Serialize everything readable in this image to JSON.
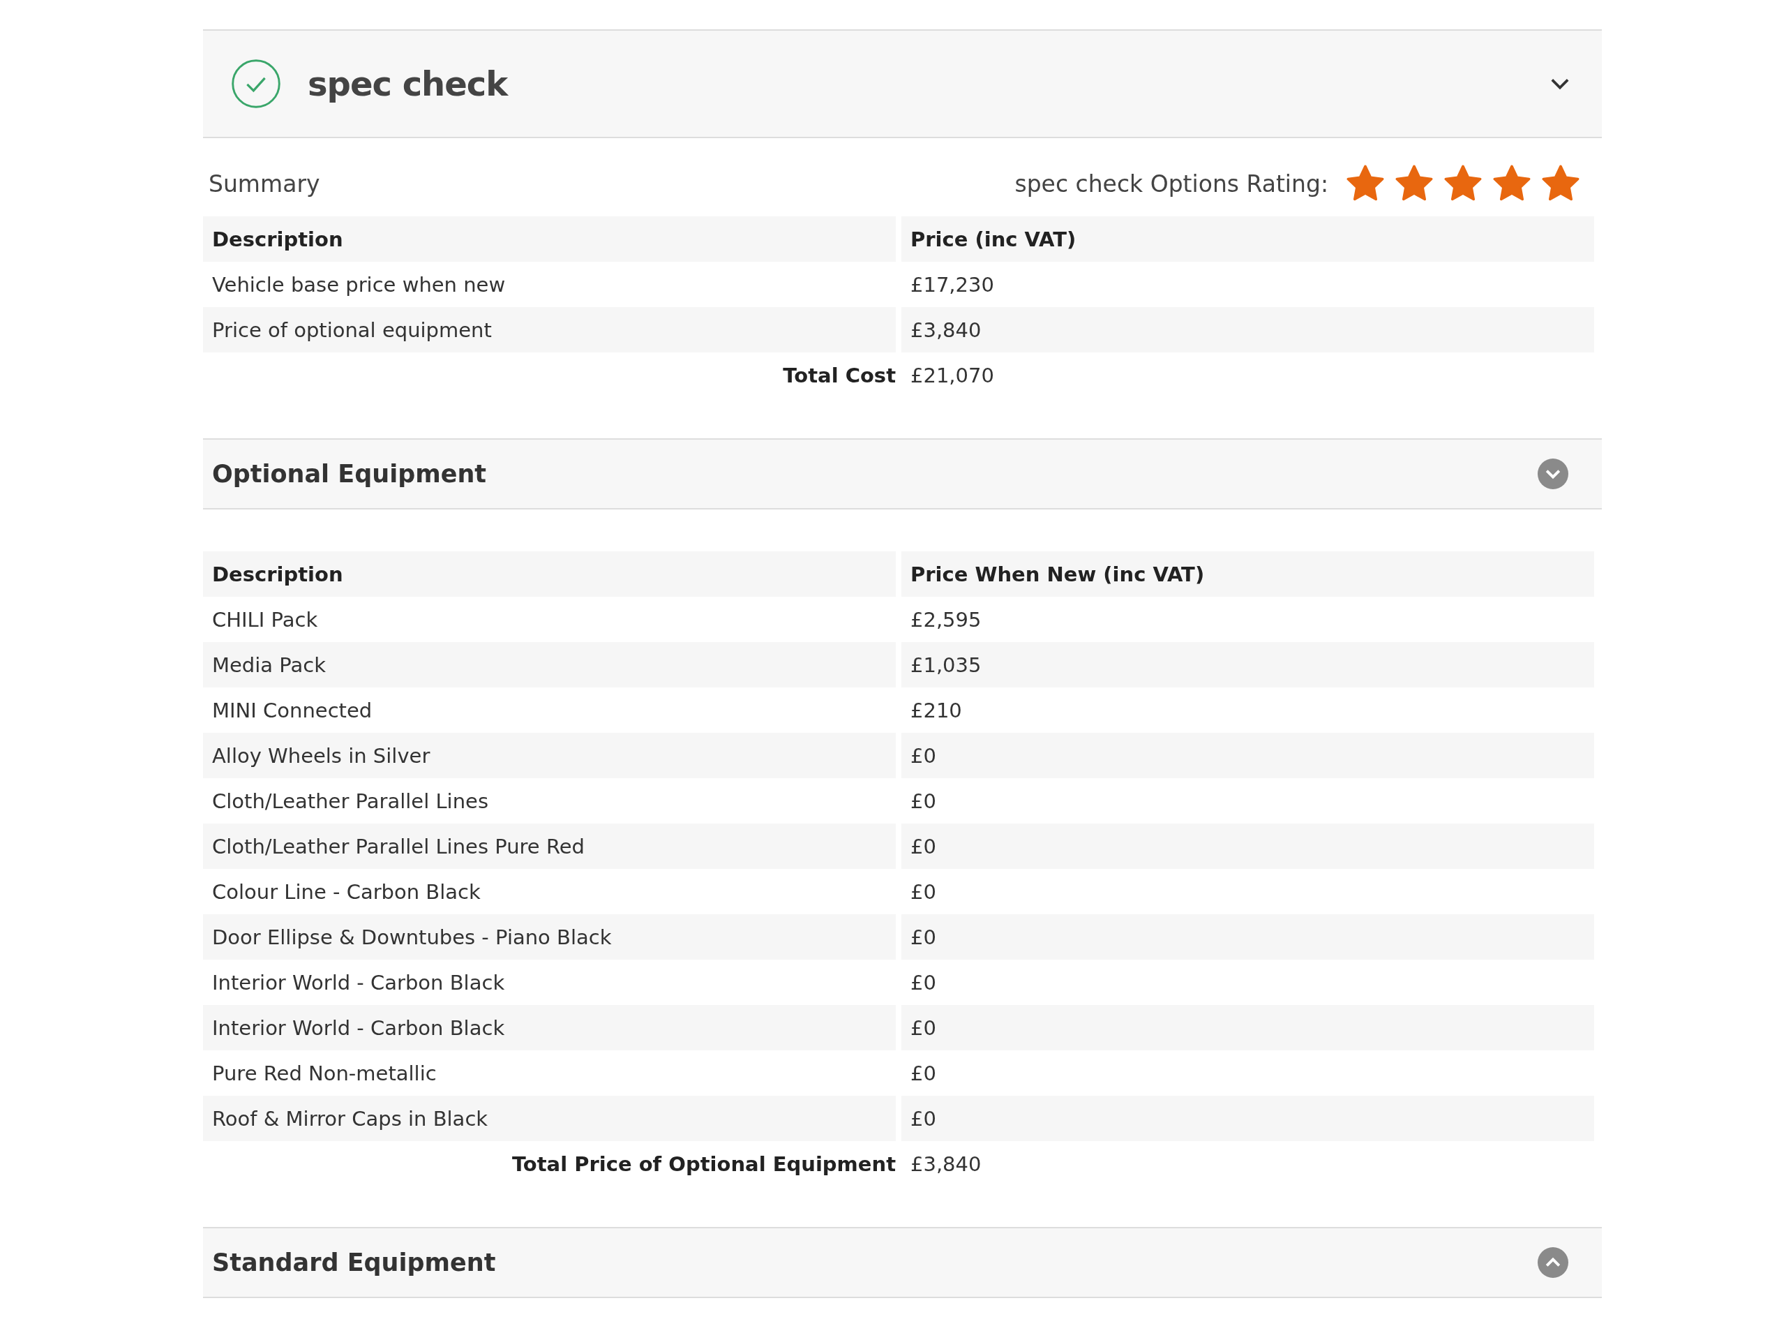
{
  "header": {
    "title": "spec check",
    "expanded": true
  },
  "summary": {
    "title": "Summary",
    "rating_label": "spec check Options Rating:",
    "stars": 5,
    "columns": [
      "Description",
      "Price (inc VAT)"
    ],
    "rows": [
      [
        "Vehicle base price when new",
        "£17,230"
      ],
      [
        "Price of optional equipment",
        "£3,840"
      ]
    ],
    "total": {
      "label": "Total Cost",
      "value": "£21,070"
    }
  },
  "sections": [
    {
      "title": "Optional Equipment",
      "expanded": true,
      "columns": [
        "Description",
        "Price When New (inc VAT)"
      ],
      "rows": [
        [
          "CHILI Pack",
          "£2,595"
        ],
        [
          "Media Pack",
          "£1,035"
        ],
        [
          "MINI Connected",
          "£210"
        ],
        [
          "Alloy Wheels in Silver",
          "£0"
        ],
        [
          "Cloth/Leather Parallel Lines",
          "£0"
        ],
        [
          "Cloth/Leather Parallel Lines Pure Red",
          "£0"
        ],
        [
          "Colour Line - Carbon Black",
          "£0"
        ],
        [
          "Door Ellipse & Downtubes - Piano Black",
          "£0"
        ],
        [
          "Interior World - Carbon Black",
          "£0"
        ],
        [
          "Interior World - Carbon Black",
          "£0"
        ],
        [
          "Pure Red Non-metallic",
          "£0"
        ],
        [
          "Roof & Mirror Caps in Black",
          "£0"
        ]
      ],
      "total": {
        "label": "Total Price of Optional Equipment",
        "value": "£3,840"
      }
    },
    {
      "title": "Standard Equipment",
      "expanded": false
    }
  ]
}
